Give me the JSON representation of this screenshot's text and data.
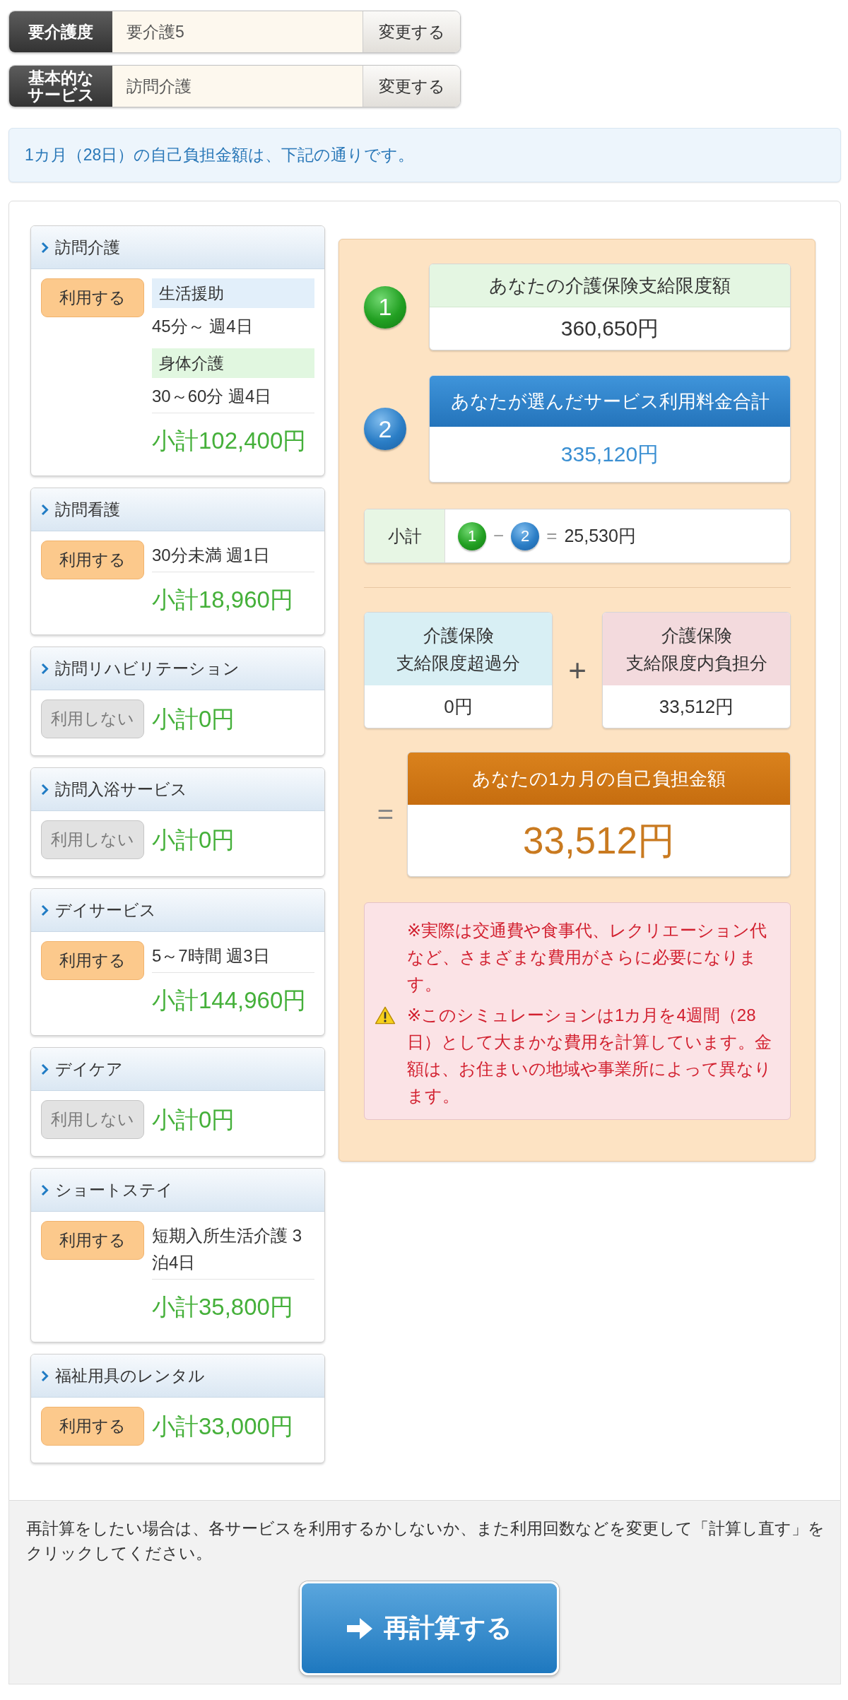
{
  "settings": [
    {
      "label_lines": [
        "要介護度"
      ],
      "value": "要介護5",
      "button": "変更する"
    },
    {
      "label_lines": [
        "基本的な",
        "サービス"
      ],
      "value": "訪問介護",
      "button": "変更する"
    }
  ],
  "notice": "1カ月（28日）の自己負担金額は、下記の通りです。",
  "services": [
    {
      "title": "訪問介護",
      "used": true,
      "toggle": "利用する",
      "details": [
        {
          "kind": "category",
          "text": "生活援助",
          "color": "#e2effa"
        },
        {
          "kind": "line",
          "text": "45分～ 週4日"
        },
        {
          "kind": "category",
          "text": "身体介護",
          "color": "#e1f7e0"
        },
        {
          "kind": "line",
          "text": "30～60分 週4日"
        }
      ],
      "subtotal": "小計102,400円"
    },
    {
      "title": "訪問看護",
      "used": true,
      "toggle": "利用する",
      "details": [
        {
          "kind": "line",
          "text": "30分未満 週1日"
        }
      ],
      "subtotal": "小計18,960円"
    },
    {
      "title": "訪問リハビリテーション",
      "used": false,
      "toggle": "利用しない",
      "subtotal": "小計0円"
    },
    {
      "title": "訪問入浴サービス",
      "used": false,
      "toggle": "利用しない",
      "subtotal": "小計0円"
    },
    {
      "title": "デイサービス",
      "used": true,
      "toggle": "利用する",
      "details": [
        {
          "kind": "line",
          "text": "5～7時間 週3日"
        }
      ],
      "subtotal": "小計144,960円"
    },
    {
      "title": "デイケア",
      "used": false,
      "toggle": "利用しない",
      "subtotal": "小計0円"
    },
    {
      "title": "ショートステイ",
      "used": true,
      "toggle": "利用する",
      "details": [
        {
          "kind": "line",
          "text": "短期入所生活介護 3泊4日"
        }
      ],
      "subtotal": "小計35,800円"
    },
    {
      "title": "福祉用具のレンタル",
      "used": true,
      "toggle": "利用する",
      "subtotal": "小計33,000円"
    }
  ],
  "summary": {
    "steps": [
      {
        "kind": "limit",
        "number": "1",
        "title": "あなたの介護保険支給限度額",
        "amount": "360,650円"
      },
      {
        "kind": "total",
        "number": "2",
        "title": "あなたが選んだサービス利用料金合計",
        "amount": "335,120円"
      }
    ],
    "subtotal": {
      "label": "小計",
      "formula": [
        {
          "kind": "limit",
          "text": "1"
        },
        {
          "kind": "operator",
          "text": "−"
        },
        {
          "kind": "total",
          "text": "2"
        },
        {
          "kind": "operator",
          "text": "="
        },
        {
          "kind": "amount",
          "text": "25,530円"
        }
      ]
    },
    "breakdown": [
      {
        "kind": "excess",
        "title_lines": [
          "介護保険",
          "支給限度超過分"
        ],
        "amount": "0円"
      },
      {
        "kind": "within",
        "title_lines": [
          "介護保険",
          "支給限度内負担分"
        ],
        "amount": "33,512円"
      }
    ],
    "plus": "+",
    "equals": "=",
    "result": {
      "title": "あなたの1カ月の自己負担金額",
      "amount": "33,512円"
    },
    "notes": [
      {
        "text": "※実際は交通費や食事代、レクリエーション代など、さまざまな費用がさらに必要になります。",
        "warning": false
      },
      {
        "text": "※このシミュレーションは1カ月を4週間（28日）として大まかな費用を計算しています。金額は、お住まいの地域や事業所によって異なります。",
        "warning": true
      }
    ]
  },
  "footer": {
    "text": "再計算をしたい場合は、各サービスを利用するかしないか、また利用回数などを変更して「計算し直す」をクリックしてください。",
    "button": "再計算する"
  }
}
